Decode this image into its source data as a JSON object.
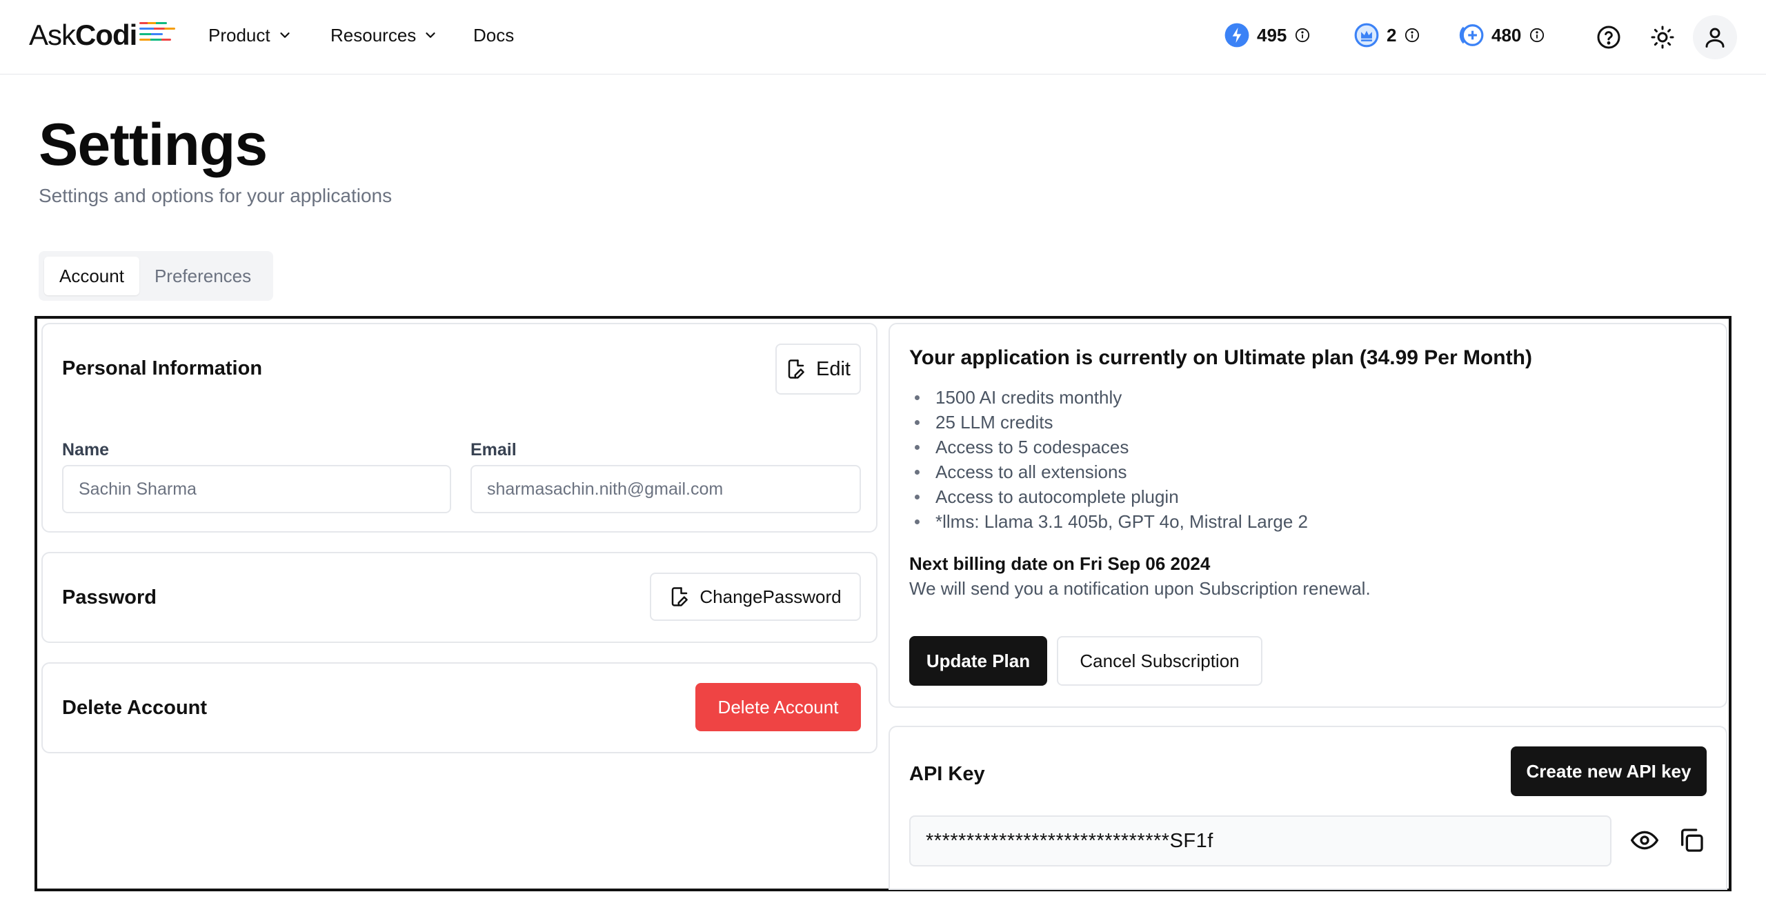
{
  "nav": {
    "logo_ask": "Ask",
    "logo_codi": "Codi",
    "logo_colors": [
      "#ef4444",
      "#f59e0b",
      "#10b981",
      "#3b82f6"
    ],
    "menu": [
      {
        "label": "Product",
        "has_dropdown": true
      },
      {
        "label": "Resources",
        "has_dropdown": true
      },
      {
        "label": "Docs",
        "has_dropdown": false
      }
    ],
    "credits": [
      {
        "icon": "bolt-icon",
        "value": "495",
        "color": "#3b82f6"
      },
      {
        "icon": "crown-icon",
        "value": "2",
        "color": "#3b82f6"
      },
      {
        "icon": "plus-coin-icon",
        "value": "480",
        "color": "#3b82f6"
      }
    ]
  },
  "header": {
    "title": "Settings",
    "subtitle": "Settings and options for your applications"
  },
  "tabs": [
    {
      "label": "Account",
      "active": true
    },
    {
      "label": "Preferences",
      "active": false
    }
  ],
  "personal": {
    "title": "Personal Information",
    "edit_label": "Edit",
    "name_label": "Name",
    "name_value": "Sachin Sharma",
    "email_label": "Email",
    "email_value": "sharmasachin.nith@gmail.com"
  },
  "password": {
    "title": "Password",
    "button_label": "ChangePassword"
  },
  "delete": {
    "title": "Delete Account",
    "button_label": "Delete Account",
    "button_color": "#ef4444"
  },
  "plan": {
    "title": "Your application is currently on Ultimate plan (34.99 Per Month)",
    "features": [
      "1500 AI credits monthly",
      "25 LLM credits",
      "Access to 5 codespaces",
      "Access to all extensions",
      "Access to autocomplete plugin",
      "*llms: Llama 3.1 405b, GPT 4o, Mistral Large 2"
    ],
    "billing": "Next billing date on Fri Sep 06 2024",
    "billing_note": "We will send you a notification upon Subscription renewal.",
    "update_label": "Update Plan",
    "cancel_label": "Cancel Subscription"
  },
  "api": {
    "title": "API Key",
    "create_label": "Create new API key",
    "key_value": "******************************SF1f"
  }
}
